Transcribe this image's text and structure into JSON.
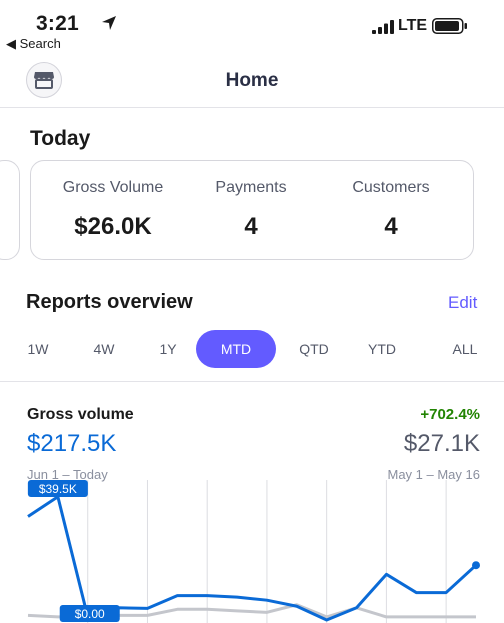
{
  "status_bar": {
    "time": "3:21",
    "back_label": "◀ Search",
    "carrier": "LTE"
  },
  "nav": {
    "title": "Home",
    "store_icon": "store-icon"
  },
  "today": {
    "title": "Today",
    "metrics": [
      {
        "label": "Gross Volume",
        "value": "$26.0K"
      },
      {
        "label": "Payments",
        "value": "4"
      },
      {
        "label": "Customers",
        "value": "4"
      }
    ]
  },
  "reports": {
    "title": "Reports overview",
    "edit_label": "Edit",
    "tabs": [
      "1W",
      "4W",
      "1Y",
      "MTD",
      "QTD",
      "YTD",
      "ALL"
    ],
    "active_tab": "MTD"
  },
  "gross_volume": {
    "title": "Gross volume",
    "change": "+702.4%",
    "value": "$217.5K",
    "range": "Jun 1 – Today",
    "previous_value": "$27.1K",
    "previous_range": "May 1 – May 16"
  },
  "colors": {
    "accent": "#635bff",
    "current_series": "#0a6ad6",
    "previous_series": "#c4c6cc",
    "positive": "#228403"
  },
  "chart_data": {
    "type": "line",
    "annotations": [
      "$39.5K",
      "$0.00"
    ],
    "series": [
      {
        "values": [
          33,
          39.5,
          0,
          3,
          2.8,
          7,
          7,
          6.5,
          5.5,
          3.5,
          -1,
          3,
          14,
          8,
          8,
          17
        ]
      },
      {
        "values": [
          0.5,
          0,
          0,
          0.5,
          0.5,
          2.5,
          2.5,
          2,
          1.5,
          4,
          0,
          3,
          0,
          0,
          0,
          0
        ]
      }
    ],
    "ylim": [
      -2,
      45
    ]
  }
}
